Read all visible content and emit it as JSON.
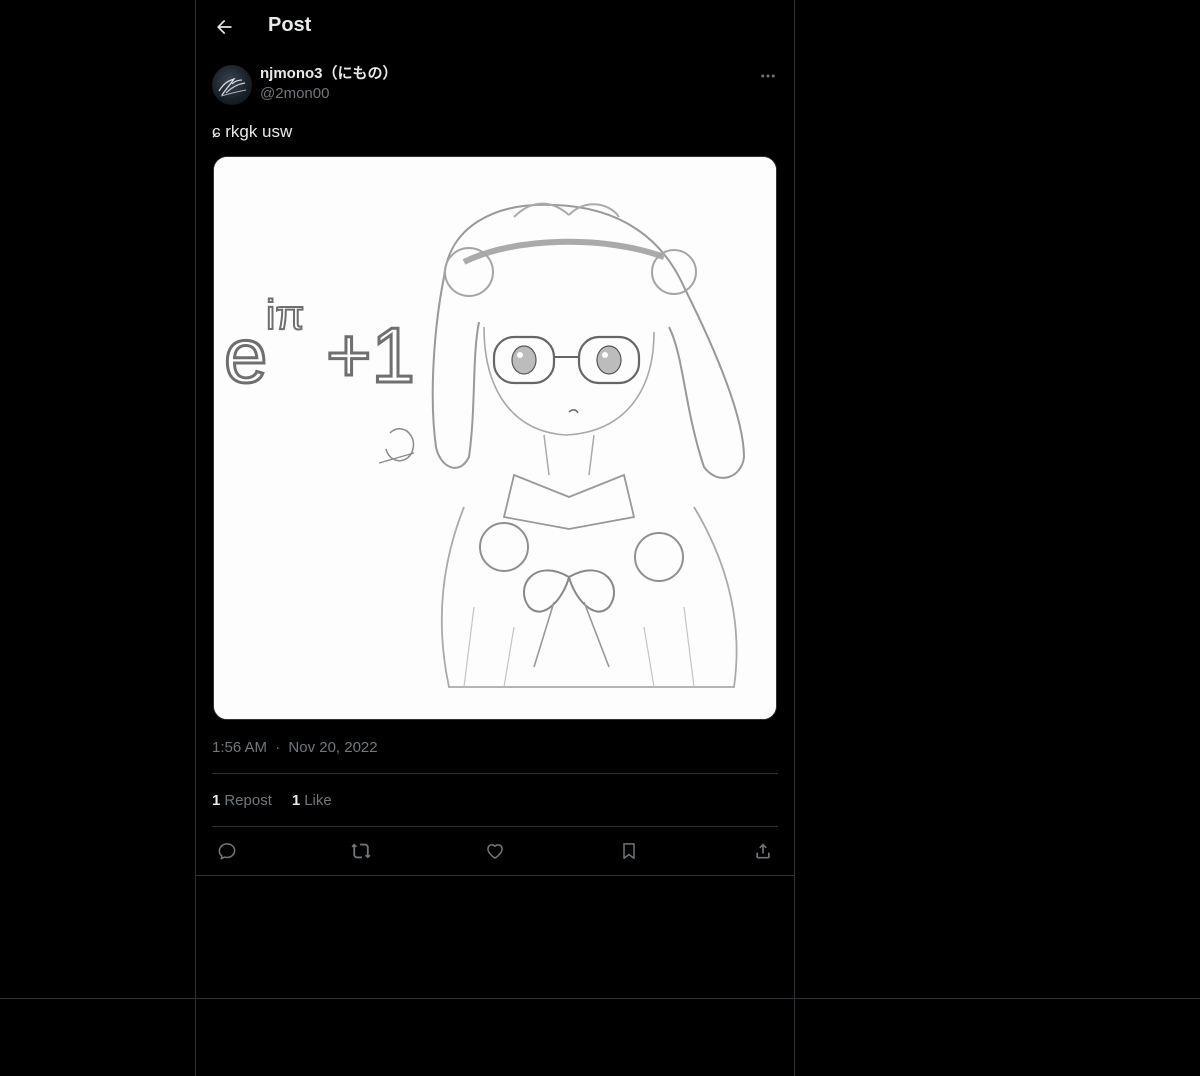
{
  "header": {
    "title": "Post"
  },
  "author": {
    "display_name": "njmono3（にもの）",
    "handle": "@2mon00"
  },
  "post": {
    "text": "ɕ rkgk usw",
    "time": "1:56 AM",
    "separator": "·",
    "date": "Nov 20, 2022",
    "media_formula": "e",
    "media_superscript": "iπ",
    "media_suffix": "+1"
  },
  "stats": {
    "reposts_count": "1",
    "reposts_label": "Repost",
    "likes_count": "1",
    "likes_label": "Like"
  },
  "icons": {
    "back": "arrow-left-icon",
    "more": "more-horizontal-icon",
    "reply": "reply-icon",
    "repost": "repost-icon",
    "like": "heart-icon",
    "bookmark": "bookmark-icon",
    "share": "share-icon"
  },
  "colors": {
    "background": "#000000",
    "text": "#e7e9ea",
    "muted": "#71767b",
    "border": "#2f3336"
  }
}
